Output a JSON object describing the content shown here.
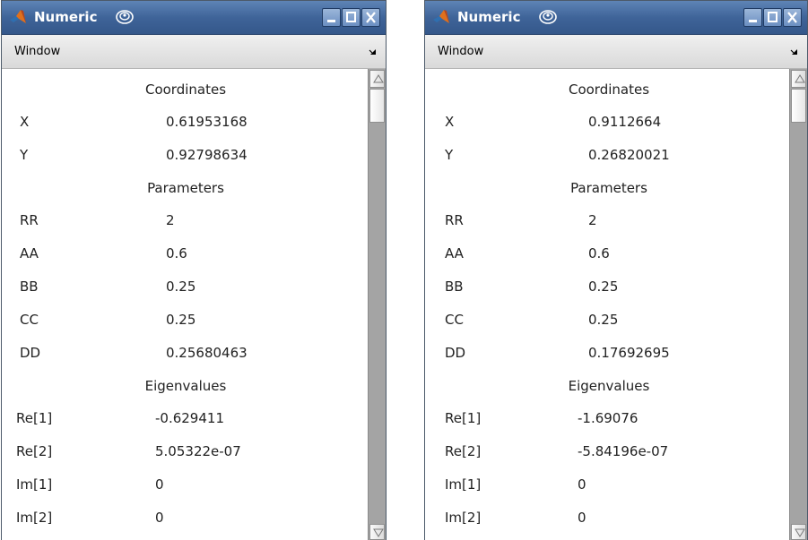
{
  "windows": [
    {
      "title": "Numeric",
      "menu": "Window",
      "sections": {
        "coordinates": "Coordinates",
        "parameters": "Parameters",
        "eigenvalues": "Eigenvalues"
      },
      "coordinates": [
        {
          "label": "X",
          "value": "0.61953168"
        },
        {
          "label": "Y",
          "value": "0.92798634"
        }
      ],
      "parameters": [
        {
          "label": "RR",
          "value": "2"
        },
        {
          "label": "AA",
          "value": "0.6"
        },
        {
          "label": "BB",
          "value": "0.25"
        },
        {
          "label": "CC",
          "value": "0.25"
        },
        {
          "label": "DD",
          "value": "0.25680463"
        }
      ],
      "eigenvalues": [
        {
          "label": "Re[1]",
          "value": "-0.629411"
        },
        {
          "label": "Re[2]",
          "value": "5.05322e-07"
        },
        {
          "label": "Im[1]",
          "value": "0"
        },
        {
          "label": "Im[2]",
          "value": "0"
        }
      ]
    },
    {
      "title": "Numeric",
      "menu": "Window",
      "sections": {
        "coordinates": "Coordinates",
        "parameters": "Parameters",
        "eigenvalues": "Eigenvalues"
      },
      "coordinates": [
        {
          "label": "X",
          "value": "0.9112664"
        },
        {
          "label": "Y",
          "value": "0.26820021"
        }
      ],
      "parameters": [
        {
          "label": "RR",
          "value": "2"
        },
        {
          "label": "AA",
          "value": "0.6"
        },
        {
          "label": "BB",
          "value": "0.25"
        },
        {
          "label": "CC",
          "value": "0.25"
        },
        {
          "label": "DD",
          "value": "0.17692695"
        }
      ],
      "eigenvalues": [
        {
          "label": "Re[1]",
          "value": "-1.69076"
        },
        {
          "label": "Re[2]",
          "value": "-5.84196e-07"
        },
        {
          "label": "Im[1]",
          "value": "0"
        },
        {
          "label": "Im[2]",
          "value": "0"
        }
      ]
    }
  ],
  "colors": {
    "titlebar": "#3f6499",
    "menubar": "#e4e4e4",
    "scrollbar_track": "#a4a4a4"
  },
  "icons": [
    "matlab-logo-icon",
    "swirl-icon",
    "minimize-icon",
    "maximize-icon",
    "close-icon",
    "menu-arrow-icon",
    "scroll-up-arrow-icon",
    "scroll-down-arrow-icon"
  ]
}
